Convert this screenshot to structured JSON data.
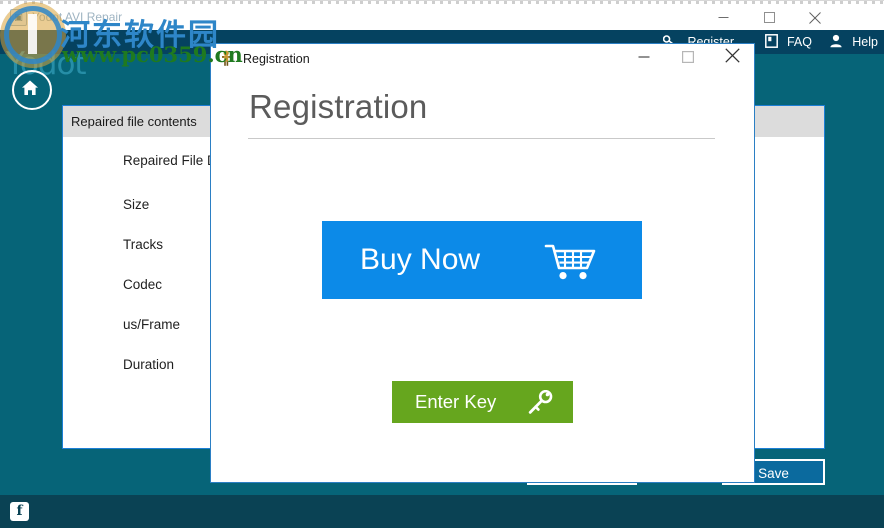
{
  "app_window": {
    "title": "Yodot AVI Repair",
    "icon": "app-icon",
    "window_controls": {
      "minimize": "minimize-icon",
      "maximize": "maximize-icon",
      "close": "close-icon"
    },
    "menu": [
      {
        "id": "register",
        "label": "Register",
        "icon": "key-icon"
      },
      {
        "id": "faq",
        "label": "FAQ",
        "icon": "book-icon"
      },
      {
        "id": "help",
        "label": "Help",
        "icon": "person-icon"
      }
    ],
    "brand": {
      "name": "Yodot",
      "home_button_icon": "home-icon"
    },
    "panel": {
      "header": "Repaired file contents",
      "fields": [
        {
          "label": "Repaired File D",
          "value": ""
        },
        {
          "label": "Size",
          "value": ""
        },
        {
          "label": "Tracks",
          "value": ""
        },
        {
          "label": "Codec",
          "value": ""
        },
        {
          "label": "us/Frame",
          "value": ""
        },
        {
          "label": "Duration",
          "value": ""
        }
      ]
    },
    "actions": {
      "back_label": "",
      "save_label": "Save"
    },
    "footer": {
      "facebook_icon": "facebook-icon",
      "facebook_label": "f"
    }
  },
  "registration_dialog": {
    "titlebar": {
      "icon": "registration-icon",
      "title": "Registration",
      "minimize": "minimize-icon",
      "maximize": "maximize-icon",
      "close": "close-icon"
    },
    "heading": "Registration",
    "buy_now": {
      "label": "Buy Now",
      "icon": "shopping-cart-icon",
      "color": "#0c8ae8"
    },
    "enter_key": {
      "label": "Enter Key",
      "icon": "key-icon",
      "color": "#66a61e"
    }
  },
  "watermark": {
    "site_name": "河东软件园",
    "site_url": "www.pc0359.cn"
  },
  "colors": {
    "teal_body": "#066478",
    "menu_navy": "#054260",
    "accent_blue": "#1c7fd6",
    "footer": "#0a4254",
    "buy_blue": "#0c8ae8",
    "key_green": "#66a61e"
  }
}
